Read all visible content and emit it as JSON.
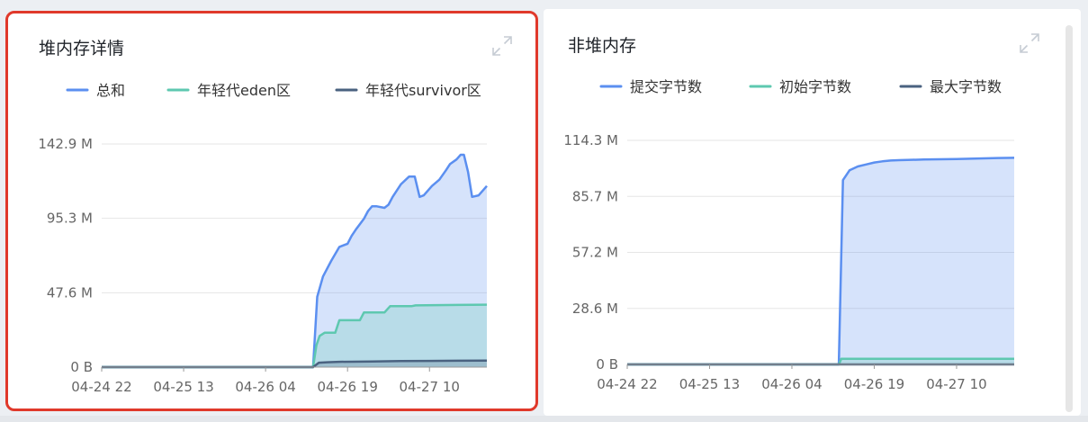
{
  "left_card": {
    "title": "堆内存详情",
    "expand_icon": "expand-icon"
  },
  "right_card": {
    "title": "非堆内存",
    "expand_icon": "expand-icon"
  },
  "colors": {
    "blue": "#5b8ff0",
    "teal": "#5ec8b0",
    "navy": "#4a6280",
    "grid": "#e6e6e6",
    "axis_text": "#666666",
    "card_border_highlight": "#e0392b"
  },
  "chart_data": [
    {
      "type": "area",
      "legend_position": "top-center",
      "grid": true,
      "categories": [
        "04-24 22",
        "04-25 13",
        "04-26 04",
        "04-26 19",
        "04-27 10"
      ],
      "y_tick_labels": [
        "0 B",
        "47.6 M",
        "95.3 M",
        "142.9 M"
      ],
      "ylim": [
        0,
        142.9
      ],
      "xlim": [
        0,
        4.7
      ],
      "series": [
        {
          "name": "总和",
          "color": "#5b8ff0",
          "x": [
            0,
            2.58,
            2.63,
            2.7,
            2.8,
            2.9,
            3.0,
            3.05,
            3.1,
            3.2,
            3.25,
            3.3,
            3.35,
            3.45,
            3.5,
            3.55,
            3.65,
            3.75,
            3.82,
            3.88,
            3.93,
            4.03,
            4.12,
            4.2,
            4.25,
            4.33,
            4.38,
            4.42,
            4.47,
            4.52,
            4.6,
            4.7
          ],
          "values": [
            0,
            0,
            45,
            58,
            68,
            77,
            79,
            84,
            88,
            95,
            100,
            103,
            103,
            102,
            104,
            109,
            117,
            122,
            122,
            109,
            110,
            116,
            120,
            126,
            130,
            133,
            136,
            136,
            125,
            109,
            110,
            116
          ]
        },
        {
          "name": "年轻代eden区",
          "color": "#5ec8b0",
          "x": [
            0,
            2.58,
            2.62,
            2.66,
            2.72,
            2.85,
            2.9,
            3.15,
            3.2,
            3.45,
            3.52,
            3.78,
            3.83,
            4.7
          ],
          "values": [
            0,
            0,
            14,
            20,
            22,
            22,
            30,
            30,
            35,
            35,
            39,
            39,
            39.5,
            40
          ]
        },
        {
          "name": "年轻代survivor区",
          "color": "#4a6280",
          "x": [
            0,
            2.58,
            2.65,
            2.75,
            2.9,
            3.3,
            3.65,
            4.0,
            4.35,
            4.7
          ],
          "values": [
            0,
            0,
            2.8,
            3.1,
            3.4,
            3.6,
            3.9,
            4.0,
            4.1,
            4.2
          ]
        }
      ]
    },
    {
      "type": "area",
      "legend_position": "top-center",
      "grid": true,
      "categories": [
        "04-24 22",
        "04-25 13",
        "04-26 04",
        "04-26 19",
        "04-27 10"
      ],
      "y_tick_labels": [
        "0 B",
        "28.6 M",
        "57.2 M",
        "85.7 M",
        "114.3 M"
      ],
      "ylim": [
        0,
        114.3
      ],
      "xlim": [
        0,
        4.7
      ],
      "series": [
        {
          "name": "提交字节数",
          "color": "#5b8ff0",
          "x": [
            0,
            2.57,
            2.62,
            2.7,
            2.8,
            2.9,
            3.0,
            3.1,
            3.2,
            3.3,
            3.6,
            4.0,
            4.5,
            4.7
          ],
          "values": [
            0,
            0,
            94,
            99,
            101,
            102,
            103,
            103.6,
            104,
            104.2,
            104.5,
            104.8,
            105.3,
            105.4
          ]
        },
        {
          "name": "初始字节数",
          "color": "#5ec8b0",
          "x": [
            0,
            2.57,
            2.6,
            4.7
          ],
          "values": [
            0,
            0,
            2.9,
            2.9
          ]
        },
        {
          "name": "最大字节数",
          "color": "#4a6280",
          "x": [
            0,
            4.7
          ],
          "values": [
            0,
            0
          ]
        }
      ]
    }
  ]
}
